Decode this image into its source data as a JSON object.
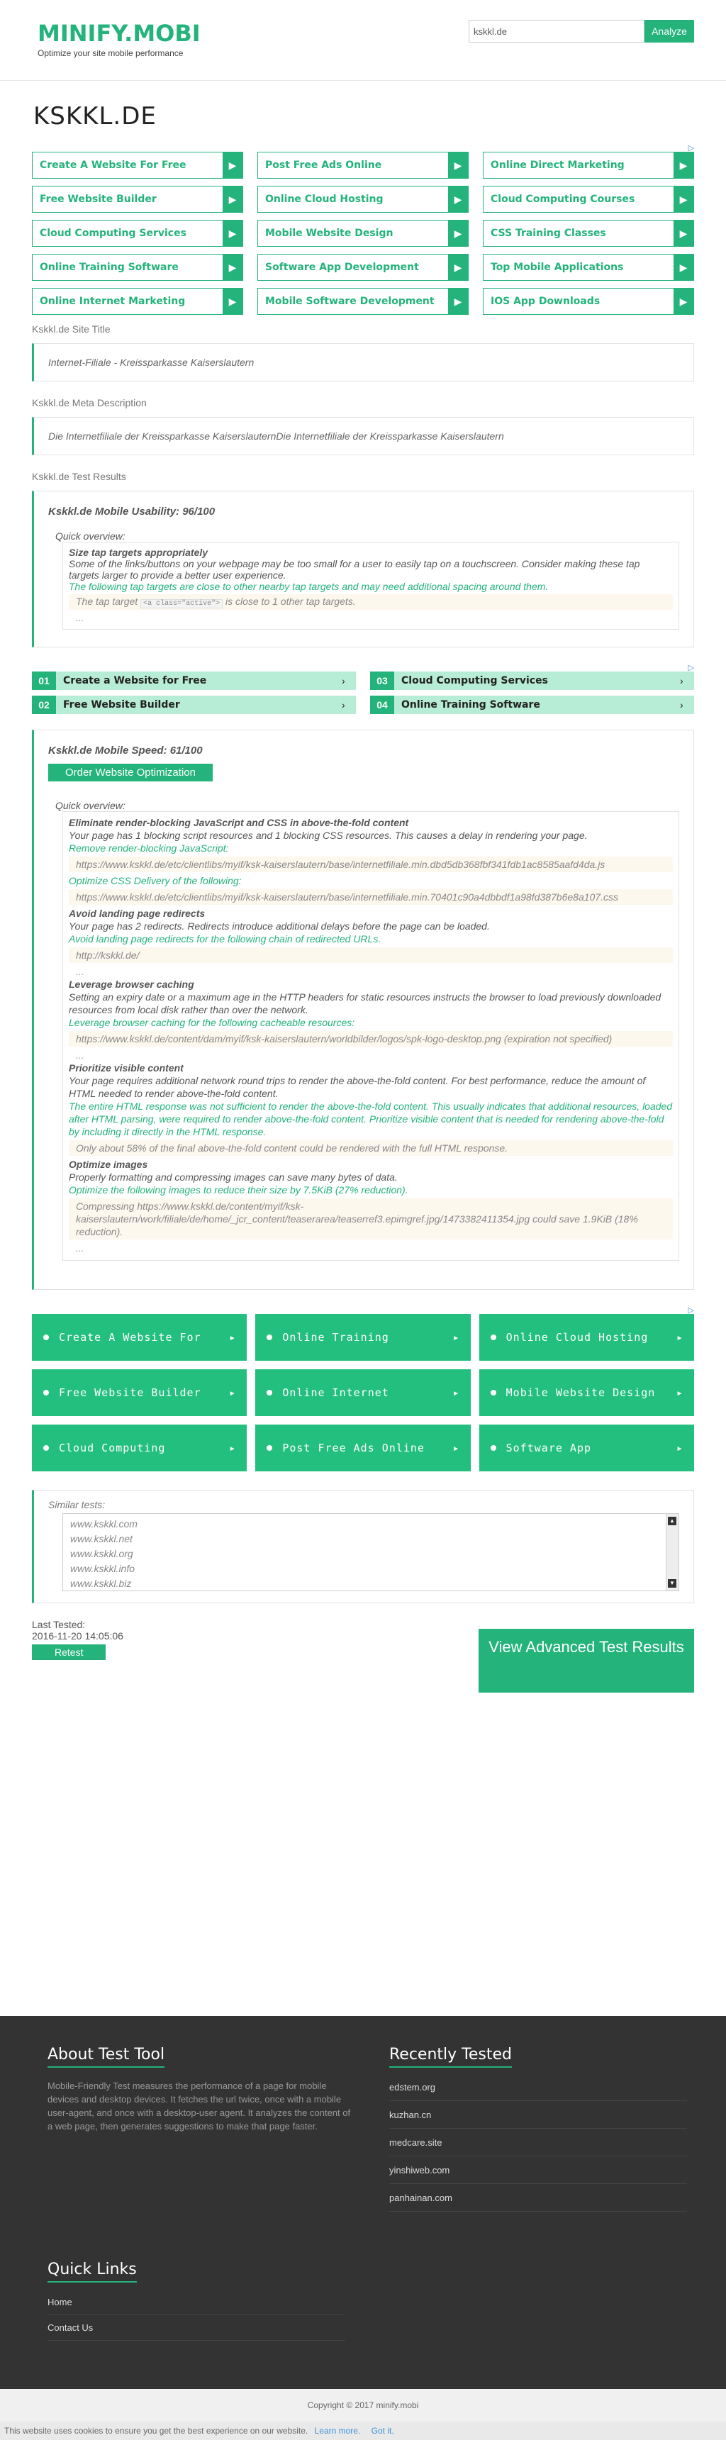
{
  "header": {
    "logo": "MINIFY.MOBI",
    "tagline": "Optimize your site mobile performance",
    "search_value": "kskkl.de",
    "analyze_label": "Analyze"
  },
  "page_title": "KSKKL.DE",
  "adchoice_icon": "adchoices-triangle-icon",
  "ads_top": [
    "Create A Website For Free",
    "Post Free Ads Online",
    "Online Direct Marketing",
    "Free Website Builder",
    "Online Cloud Hosting",
    "Cloud Computing Courses",
    "Cloud Computing Services",
    "Mobile Website Design",
    "CSS Training Classes",
    "Online Training Software",
    "Software App Development",
    "Top Mobile Applications",
    "Online Internet Marketing",
    "Mobile Software Development",
    "IOS App Downloads"
  ],
  "site_title": {
    "label": "Kskkl.de Site Title",
    "value": "Internet-Filiale - Kreissparkasse Kaiserslautern"
  },
  "meta_description": {
    "label": "Kskkl.de Meta Description",
    "value": "Die Internetfiliale der Kreissparkasse KaiserslauternDie Internetfiliale der Kreissparkasse Kaiserslautern"
  },
  "test_results_label": "Kskkl.de Test Results",
  "usability": {
    "title": "Kskkl.de Mobile Usability: 96/100",
    "quick": "Quick overview:",
    "heading": "Size tap targets appropriately",
    "text": "Some of the links/buttons on your webpage may be too small for a user to easily tap on a touchscreen. Consider making these tap targets larger to provide a better user experience.",
    "green": "The following tap targets are close to other nearby tap targets and may need additional spacing around them.",
    "code_pre": "The tap target",
    "code_badge": "<a class=\"active\">",
    "code_post": "is close to 1 other tap targets.",
    "dots": "..."
  },
  "ads_mid": [
    {
      "num": "01",
      "label": "Create a Website for Free"
    },
    {
      "num": "03",
      "label": "Cloud Computing Services"
    },
    {
      "num": "02",
      "label": "Free Website Builder"
    },
    {
      "num": "04",
      "label": "Online Training Software"
    }
  ],
  "speed": {
    "title": "Kskkl.de Mobile Speed: 61/100",
    "order_label": "Order Website Optimization",
    "quick": "Quick overview:",
    "h1": "Eliminate render-blocking JavaScript and CSS in above-the-fold content",
    "t1": "Your page has 1 blocking script resources and 1 blocking CSS resources. This causes a delay in rendering your page.",
    "g1": "Remove render-blocking JavaScript:",
    "c1": "https://www.kskkl.de/etc/clientlibs/myif/ksk-kaiserslautern/base/internetfiliale.min.dbd5db368fbf341fdb1ac8585aafd4da.js",
    "g2": "Optimize CSS Delivery of the following:",
    "c2": "https://www.kskkl.de/etc/clientlibs/myif/ksk-kaiserslautern/base/internetfiliale.min.70401c90a4dbbdf1a98fd387b6e8a107.css",
    "h2": "Avoid landing page redirects",
    "t2": "Your page has 2 redirects. Redirects introduce additional delays before the page can be loaded.",
    "g3": "Avoid landing page redirects for the following chain of redirected URLs.",
    "c3": "http://kskkl.de/",
    "h3": "Leverage browser caching",
    "t3": "Setting an expiry date or a maximum age in the HTTP headers for static resources instructs the browser to load previously downloaded resources from local disk rather than over the network.",
    "g4": "Leverage browser caching for the following cacheable resources:",
    "c4": "https://www.kskkl.de/content/dam/myif/ksk-kaiserslautern/worldbilder/logos/spk-logo-desktop.png (expiration not specified)",
    "h4": "Prioritize visible content",
    "t4": "Your page requires additional network round trips to render the above-the-fold content. For best performance, reduce the amount of HTML needed to render above-the-fold content.",
    "g5": "The entire HTML response was not sufficient to render the above-the-fold content. This usually indicates that additional resources, loaded after HTML parsing, were required to render above-the-fold content. Prioritize visible content that is needed for rendering above-the-fold by including it directly in the HTML response.",
    "c5": "Only about 58% of the final above-the-fold content could be rendered with the full HTML response.",
    "h5": "Optimize images",
    "t5": "Properly formatting and compressing images can save many bytes of data.",
    "g6": "Optimize the following images to reduce their size by 7.5KiB (27% reduction).",
    "c6": "Compressing https://www.kskkl.de/content/myif/ksk-kaiserslautern/work/filiale/de/home/_jcr_content/teaserarea/teaserref3.epimgref.jpg/1473382411354.jpg could save 1.9KiB (18% reduction).",
    "dots": "..."
  },
  "ads_tiles": [
    "Create A Website For",
    "Online Training",
    "Online Cloud Hosting",
    "Free Website Builder",
    "Online Internet",
    "Mobile Website Design",
    "Cloud Computing",
    "Post Free Ads Online",
    "Software App"
  ],
  "similar": {
    "label": "Similar tests:",
    "items": [
      "www.kskkl.com",
      "www.kskkl.net",
      "www.kskkl.org",
      "www.kskkl.info",
      "www.kskkl.biz"
    ]
  },
  "last_tested": {
    "label": "Last Tested:",
    "date": "2016-11-20 14:05:06",
    "retest_label": "Retest"
  },
  "advanced_label": "View Advanced Test Results",
  "footer": {
    "about_title": "About Test Tool",
    "about_text": "Mobile-Friendly Test measures the performance of a page for mobile devices and desktop devices. It fetches the url twice, once with a mobile user-agent, and once with a desktop-user agent. It analyzes the content of a web page, then generates suggestions to make that page faster.",
    "recent_title": "Recently Tested",
    "recent": [
      "edstem.org",
      "kuzhan.cn",
      "medcare.site",
      "yinshiweb.com",
      "panhainan.com"
    ],
    "quick_title": "Quick Links",
    "quick": [
      "Home",
      "Contact Us"
    ]
  },
  "copyright": "Copyright © 2017 minify.mobi",
  "cookie": {
    "text": "This website uses cookies to ensure you get the best experience on our website.",
    "learn": "Learn more.",
    "ok": "Got it."
  },
  "colors": {
    "accent": "#23b37b",
    "footer_bg": "#333333"
  }
}
